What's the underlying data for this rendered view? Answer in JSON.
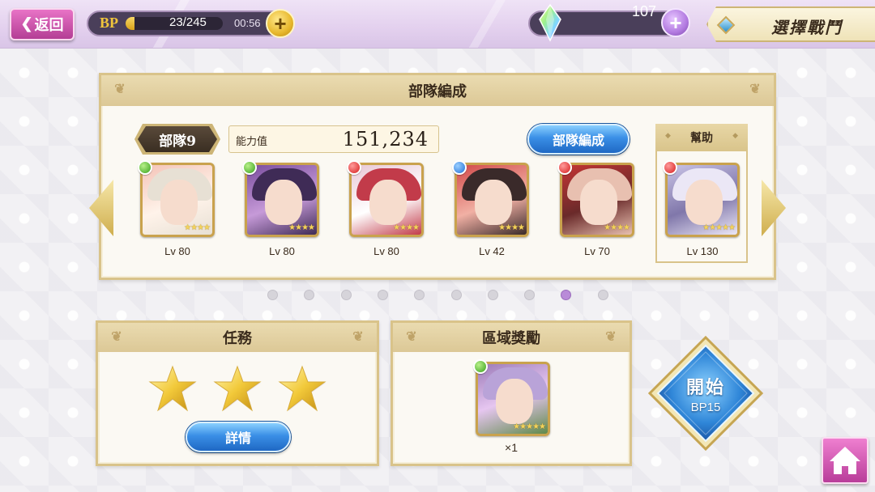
{
  "topbar": {
    "back_label": "返回",
    "bp_label": "BP",
    "bp_count": "23/245",
    "bp_fill": 0.094,
    "bp_timer": "00:56",
    "gem_count": "107",
    "stage_title": "選擇戰鬥"
  },
  "team": {
    "header": "部隊編成",
    "team_name": "部隊9",
    "power_label": "能力值",
    "power_value": "151,234",
    "formation_button": "部隊編成",
    "support_label": "幫助",
    "members": [
      {
        "level": "Lv 80",
        "attribute": "green",
        "stars": "★★★★"
      },
      {
        "level": "Lv 80",
        "attribute": "green",
        "stars": "★★★★"
      },
      {
        "level": "Lv 80",
        "attribute": "red",
        "stars": "★★★★"
      },
      {
        "level": "Lv 42",
        "attribute": "blue",
        "stars": "★★★★"
      },
      {
        "level": "Lv 70",
        "attribute": "red",
        "stars": "★★★★"
      },
      {
        "level": "Lv 130",
        "attribute": "red",
        "stars": "★★★★★"
      }
    ],
    "page_count": 10,
    "active_page": 9
  },
  "mission": {
    "header": "任務",
    "star_count": 3,
    "detail_button": "詳情"
  },
  "reward": {
    "header": "區域獎勵",
    "item_attribute": "green",
    "item_stars": "★★★★★",
    "quantity": "×1"
  },
  "start": {
    "title": "開始",
    "cost": "BP15"
  },
  "colors": {
    "accent_pink": "#b43e95",
    "gold": "#d9c38a",
    "blue_button": "#3a8fe6",
    "active_dot": "#b98bd8"
  }
}
